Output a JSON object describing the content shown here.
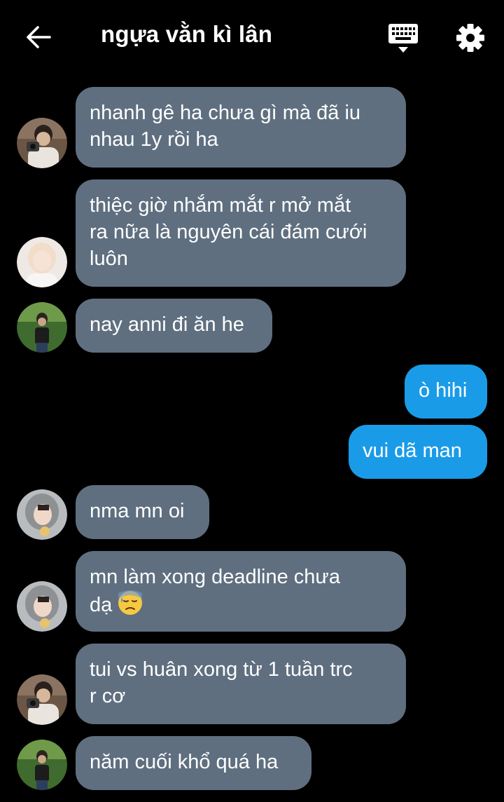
{
  "header": {
    "title": "ngựa vằn kì lân",
    "back_icon": "arrow-left-icon",
    "keyboard_icon": "keyboard-icon",
    "settings_icon": "gear-icon"
  },
  "colors": {
    "incoming_bubble": "#5f6f80",
    "outgoing_bubble": "#1a9be8",
    "background": "#000000",
    "text": "#ffffff"
  },
  "messages": [
    {
      "direction": "in",
      "lines": [
        "nhanh gê ha chưa gì mà đã iu",
        "nhau 1y rồi ha"
      ],
      "avatar": "avatar-boy-camera"
    },
    {
      "direction": "in",
      "lines": [
        "thiệc giờ nhắm mắt r mở mắt",
        "ra nữa là nguyên cái đám cưới",
        "luôn"
      ],
      "avatar": "avatar-blonde"
    },
    {
      "direction": "in",
      "lines": [
        "nay anni đi ăn he"
      ],
      "avatar": "avatar-outdoor"
    },
    {
      "direction": "out",
      "lines": [
        "ò hihi"
      ]
    },
    {
      "direction": "out",
      "lines": [
        "vui dã man"
      ]
    },
    {
      "direction": "in",
      "lines": [
        "nma mn oi"
      ],
      "avatar": "avatar-hood"
    },
    {
      "direction": "in",
      "lines": [
        "mn làm xong deadline chưa",
        "dạ"
      ],
      "emoji": "downcast-sweat-emoji",
      "avatar": "avatar-hood"
    },
    {
      "direction": "in",
      "lines": [
        "tui vs huân xong từ 1 tuần trc",
        "r cơ"
      ],
      "avatar": "avatar-boy-camera"
    },
    {
      "direction": "in",
      "lines": [
        "năm cuối khổ quá ha"
      ],
      "avatar": "avatar-outdoor"
    }
  ]
}
